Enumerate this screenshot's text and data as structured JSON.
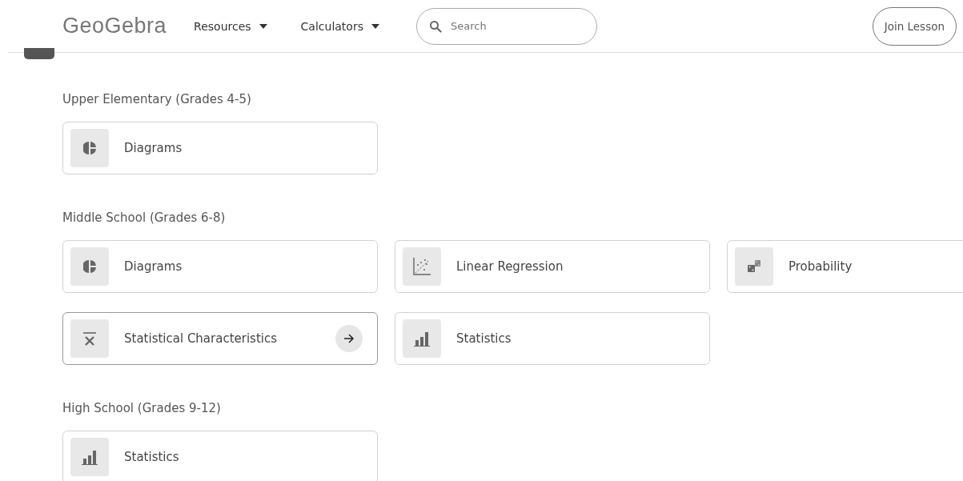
{
  "header": {
    "logo": "GeoGebra",
    "menus": [
      {
        "label": "Resources"
      },
      {
        "label": "Calculators"
      }
    ],
    "search": {
      "placeholder": "Search"
    },
    "join_button": "Join Lesson"
  },
  "sections": [
    {
      "heading": "Upper Elementary (Grades 4-5)",
      "cards": [
        {
          "kind": "pie",
          "label": "Diagrams",
          "hovered": false
        }
      ]
    },
    {
      "heading": "Middle School (Grades 6-8)",
      "cards": [
        {
          "kind": "pie",
          "label": "Diagrams",
          "hovered": false
        },
        {
          "kind": "scatter",
          "label": "Linear Regression",
          "hovered": false
        },
        {
          "kind": "dice",
          "label": "Probability",
          "hovered": false
        },
        {
          "kind": "mean",
          "label": "Statistical Characteristics",
          "hovered": true
        },
        {
          "kind": "bars",
          "label": "Statistics",
          "hovered": false
        }
      ]
    },
    {
      "heading": "High School (Grades 9-12)",
      "cards": [
        {
          "kind": "bars",
          "label": "Statistics",
          "hovered": false
        }
      ]
    }
  ]
}
